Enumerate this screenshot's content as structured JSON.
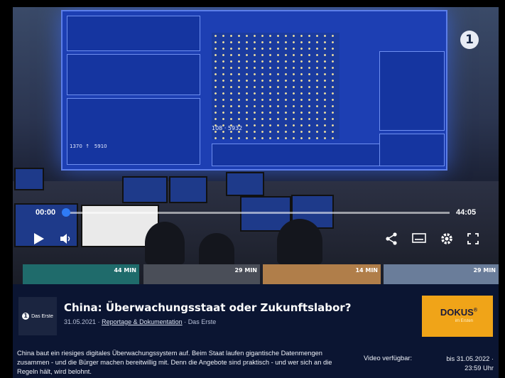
{
  "player": {
    "time_current": "00:00",
    "time_total": "44:05",
    "progress": 0,
    "channel_watermark": "1",
    "thumbnails": [
      {
        "duration": "44 MIN"
      },
      {
        "duration": ""
      },
      {
        "duration": "29 MIN"
      },
      {
        "duration": "14 MIN"
      },
      {
        "duration": "29 MIN"
      }
    ],
    "icons": [
      "play-icon",
      "volume-icon",
      "share-icon",
      "subtitles-icon",
      "settings-icon",
      "fullscreen-icon"
    ]
  },
  "info": {
    "channel_logo_text": "Das Erste",
    "title": "China: Überwachungsstaat oder Zukunftslabor?",
    "date": "31.05.2021",
    "separator": "·",
    "category_link": "Reportage & Dokumentation",
    "channel": "Das Erste",
    "badge_main": "DOKUS",
    "badge_mark": "®",
    "badge_sub": "im Ersten",
    "description": "China baut ein riesiges digitales Überwachungssystem auf. Beim Staat laufen gigantische Datenmengen zusammen - und die Bürger machen bereitwillig mit. Denn die Angebote sind praktisch - und wer sich an die Regeln hält, wird belohnt.",
    "availability_label": "Video verfügbar:",
    "availability_line1": "bis 31.05.2022 ·",
    "availability_line2": "23:59 Uhr"
  },
  "colors": {
    "accent": "#2f7bf5",
    "background": "#0b1532",
    "badge": "#f0a418"
  }
}
